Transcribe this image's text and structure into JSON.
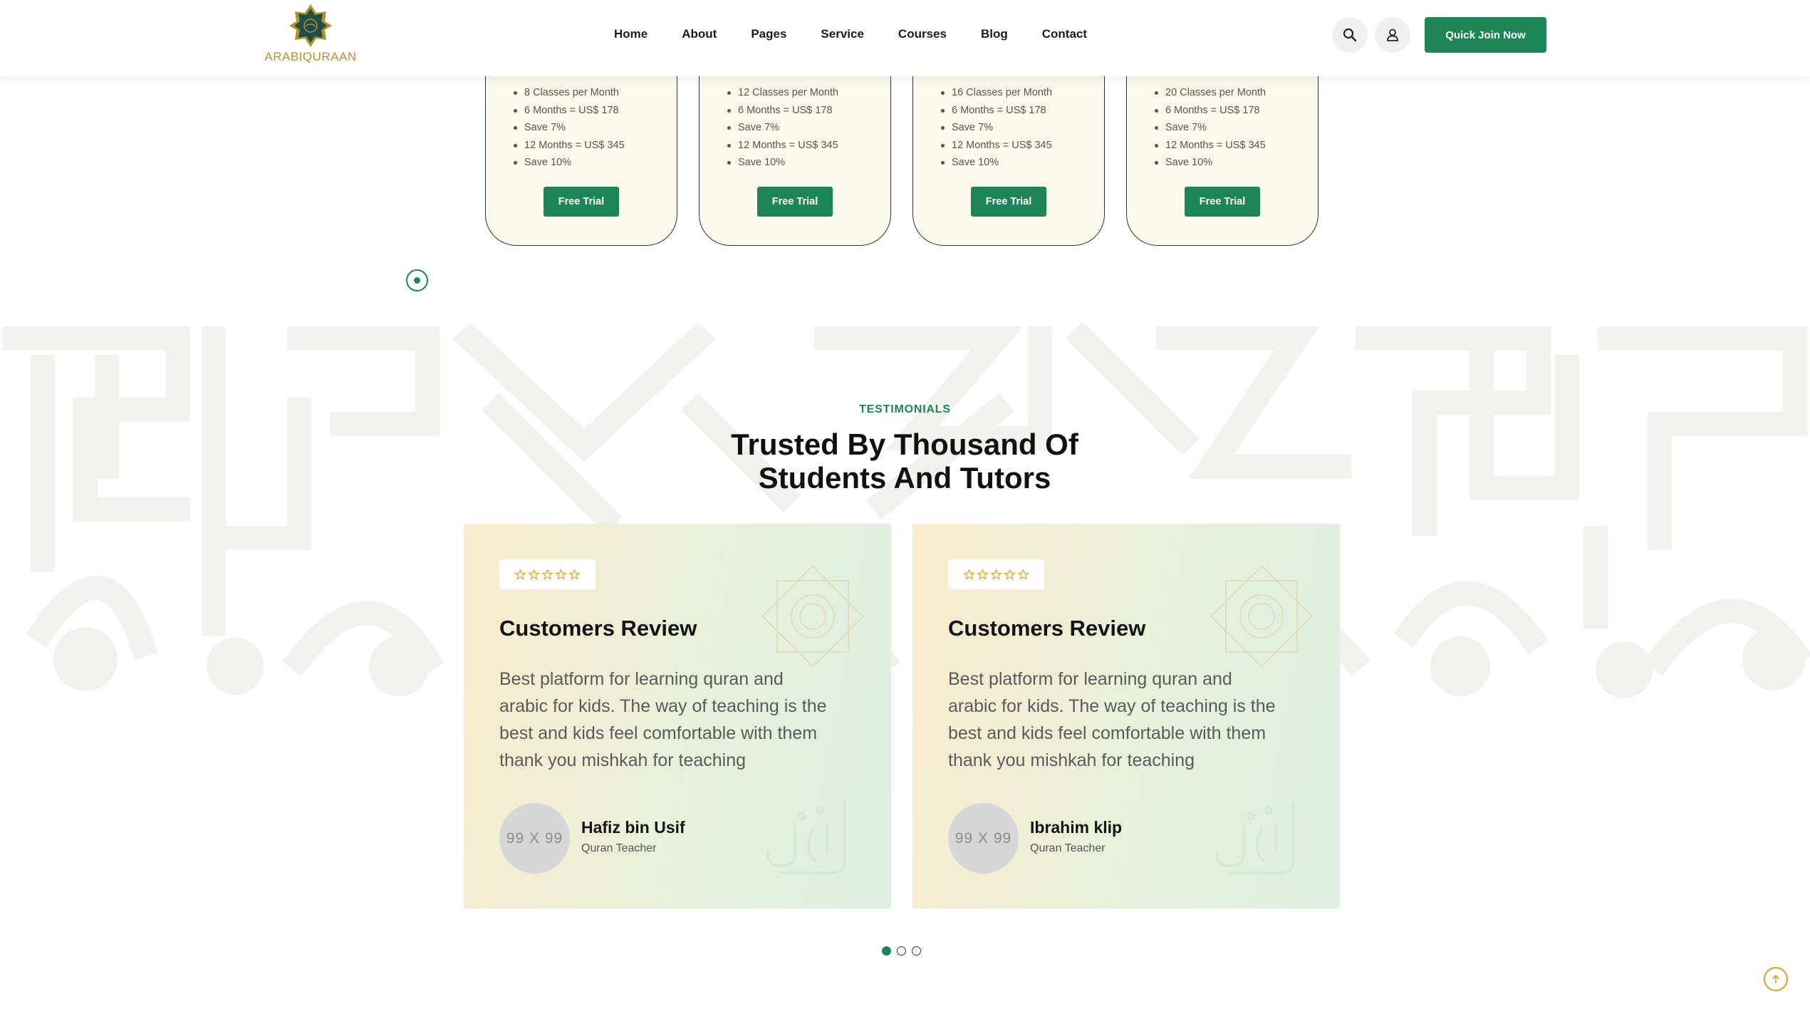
{
  "brand": {
    "name": "ARABIQURAAN",
    "accent": "#1d8556",
    "gold": "#b8902b"
  },
  "nav": {
    "items": [
      "Home",
      "About",
      "Pages",
      "Service",
      "Courses",
      "Blog",
      "Contact"
    ]
  },
  "header": {
    "search_icon": "search-icon",
    "user_icon": "user-icon",
    "cta_label": "Quick Join Now"
  },
  "pricing": {
    "cards": [
      {
        "classes": "8 Classes per Month",
        "six": "6 Months = US$ 178",
        "save_six": "Save 7%",
        "twelve": "12 Months = US$ 345",
        "save_twelve": "Save 10%",
        "button": "Free Trial"
      },
      {
        "classes": "12 Classes per Month",
        "six": "6 Months = US$ 178",
        "save_six": "Save 7%",
        "twelve": "12 Months = US$ 345",
        "save_twelve": "Save 10%",
        "button": "Free Trial"
      },
      {
        "classes": "16 Classes per Month",
        "six": "6 Months = US$ 178",
        "save_six": "Save 7%",
        "twelve": "12 Months = US$ 345",
        "save_twelve": "Save 10%",
        "button": "Free Trial"
      },
      {
        "classes": "20 Classes per Month",
        "six": "6 Months = US$ 178",
        "save_six": "Save 7%",
        "twelve": "12 Months = US$ 345",
        "save_twelve": "Save 10%",
        "button": "Free Trial"
      }
    ]
  },
  "testimonials": {
    "eyebrow": "TESTIMONIALS",
    "heading_line1": "Trusted By Thousand Of",
    "heading_line2": "Students And Tutors",
    "reviews": [
      {
        "title": "Customers Review",
        "text": "Best platform for learning quran and arabic for kids. The way of teaching is the best and kids feel comfortable with them thank you mishkah for teaching",
        "avatar_placeholder": "99 X 99",
        "name": "Hafiz bin Usif",
        "role": "Quran Teacher",
        "stars": 5
      },
      {
        "title": "Customers Review",
        "text": "Best platform for learning quran and arabic for kids. The way of teaching is the best and kids feel comfortable with them thank you mishkah for teaching",
        "avatar_placeholder": "99 X 99",
        "name": "Ibrahim klip",
        "role": "Quran Teacher",
        "stars": 5
      }
    ],
    "pager": {
      "count": 3,
      "active": 1
    }
  }
}
